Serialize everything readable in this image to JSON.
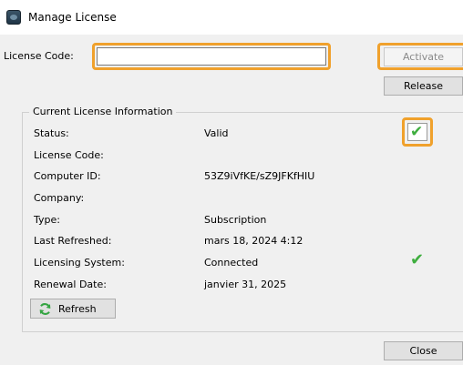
{
  "window": {
    "title": "Manage License"
  },
  "license": {
    "code_label": "License Code:",
    "code_value": "",
    "activate_label": "Activate",
    "release_label": "Release"
  },
  "group": {
    "title": "Current License Information",
    "rows": [
      {
        "label": "Status:",
        "value": "Valid"
      },
      {
        "label": "License Code:",
        "value": ""
      },
      {
        "label": "Computer ID:",
        "value": "53Z9iVfKE/sZ9JFKfHIU"
      },
      {
        "label": "Company:",
        "value": ""
      },
      {
        "label": "Type:",
        "value": "Subscription"
      },
      {
        "label": "Last Refreshed:",
        "value": "mars 18, 2024 4:12"
      },
      {
        "label": "Licensing System:",
        "value": "Connected"
      },
      {
        "label": "Renewal Date:",
        "value": "janvier 31, 2025"
      }
    ],
    "status_checkbox_checked": true,
    "licensing_system_ok": true,
    "refresh_label": "Refresh"
  },
  "footer": {
    "close_label": "Close"
  },
  "colors": {
    "highlight": "#f0a12c",
    "check": "#3fae3f"
  },
  "icons": [
    "app-icon",
    "check-icon",
    "refresh-icon"
  ]
}
